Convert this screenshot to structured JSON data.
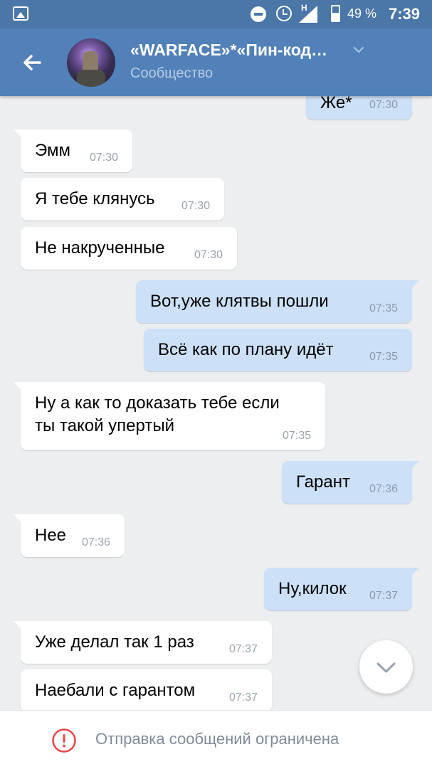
{
  "status_bar": {
    "network_label": "H",
    "battery": "49 %",
    "time": "7:39",
    "icons": [
      "gallery-icon",
      "do-not-disturb-icon",
      "alarm-icon",
      "signal-icon",
      "battery-icon"
    ]
  },
  "header": {
    "title": "«WARFACE»*«Пин-код…",
    "subtitle": "Сообщество",
    "back_icon": "arrow-left-icon",
    "chevron_icon": "chevron-down-icon"
  },
  "messages": [
    {
      "dir": "out",
      "text": "Же*",
      "time": "07:30"
    },
    {
      "dir": "in",
      "text": "Эмм",
      "time": "07:30"
    },
    {
      "dir": "in",
      "text": "Я тебе клянусь",
      "time": "07:30"
    },
    {
      "dir": "in",
      "text": "Не накрученные",
      "time": "07:30"
    },
    {
      "dir": "out",
      "text": "Вот,уже клятвы пошли",
      "time": "07:35"
    },
    {
      "dir": "out",
      "text": "Всё как по плану идёт",
      "time": "07:35"
    },
    {
      "dir": "in",
      "text_line1": "Ну а как то доказать тебе если",
      "text_line2": "ты такой упертый",
      "time": "07:35"
    },
    {
      "dir": "out",
      "text": "Гарант",
      "time": "07:36"
    },
    {
      "dir": "in",
      "text": "Нее",
      "time": "07:36"
    },
    {
      "dir": "out",
      "text": "Ну,килок",
      "time": "07:37"
    },
    {
      "dir": "in",
      "text": "Уже делал так 1 раз",
      "time": "07:37"
    },
    {
      "dir": "in",
      "text": "Наебали с гарантом",
      "time": "07:37"
    }
  ],
  "scroll_button": {
    "icon": "chevron-down-icon"
  },
  "footer": {
    "icon": "exclamation-circle-icon",
    "notice": "Отправка сообщений ограничена"
  },
  "colors": {
    "header": "#5181b8",
    "status_bar": "#4a76a8",
    "background": "#edeef0",
    "outgoing_bubble": "#cce0f7",
    "incoming_bubble": "#ffffff",
    "warning": "#e64646"
  }
}
